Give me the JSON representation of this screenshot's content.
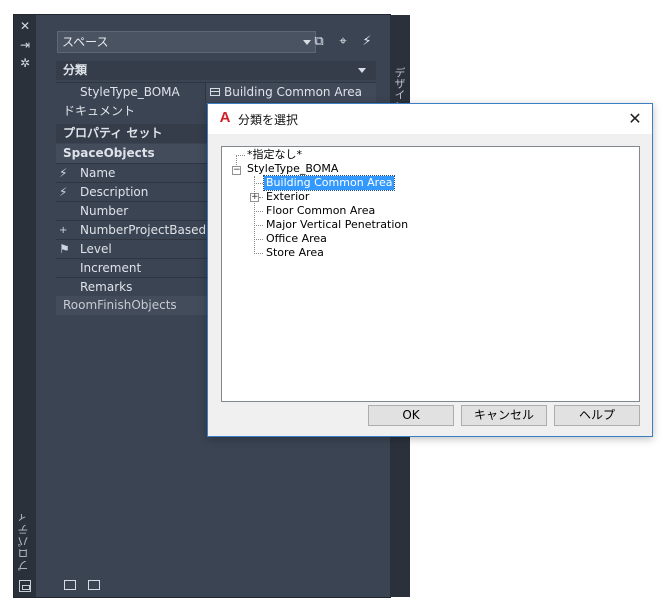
{
  "palette": {
    "side_title": "プロパティ",
    "strip_buttons": {
      "close": "✕",
      "autohide": "⇥",
      "settings": "✲"
    },
    "right_tab": "デザイン",
    "combo_value": "スペース",
    "toolbar_icons": [
      "add-style-icon",
      "select-objects-icon",
      "quick-select-icon"
    ],
    "sections": {
      "classification": "分類",
      "style_type_label": "StyleType_BOMA",
      "style_type_value": "Building Common Area",
      "document": "ドキュメント",
      "property_sets": "プロパティ セット"
    },
    "groups": {
      "space_objects": "SpaceObjects",
      "room_finish": "RoomFinishObjects"
    },
    "properties": [
      "Name",
      "Description",
      "Number",
      "NumberProjectBased",
      "Level",
      "Increment",
      "Remarks"
    ]
  },
  "dialog": {
    "title": "分類を選択",
    "close_glyph": "✕",
    "tree": {
      "none": "*指定なし*",
      "root": "StyleType_BOMA",
      "children": [
        "Building Common Area",
        "Exterior",
        "Floor Common Area",
        "Major Vertical Penetration",
        "Office Area",
        "Store Area"
      ],
      "selected": "Building Common Area"
    },
    "buttons": {
      "ok": "OK",
      "cancel": "キャンセル",
      "help": "ヘルプ"
    }
  },
  "colors": {
    "palette_bg": "#3b4453",
    "selection": "#3399ff",
    "dialog_border": "#3a7fc4"
  }
}
